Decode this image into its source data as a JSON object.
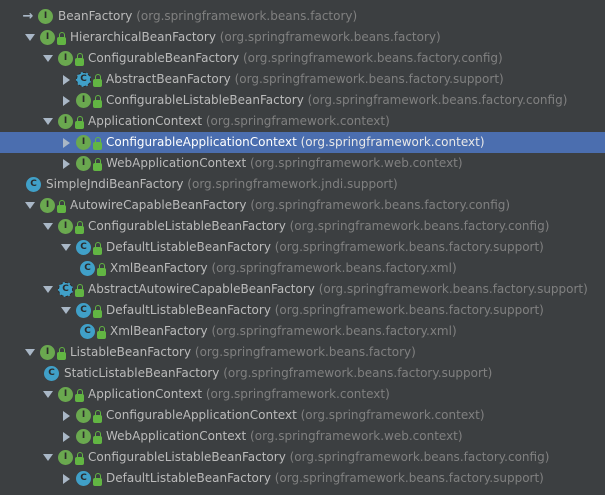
{
  "rows": [
    {
      "depth": 0,
      "expand": "root",
      "icon": "i",
      "lock": false,
      "name": "BeanFactory",
      "pkg": "(org.springframework.beans.factory)"
    },
    {
      "depth": 1,
      "expand": "down",
      "icon": "i",
      "lock": true,
      "name": "HierarchicalBeanFactory",
      "pkg": "(org.springframework.beans.factory)"
    },
    {
      "depth": 2,
      "expand": "down",
      "icon": "i",
      "lock": true,
      "name": "ConfigurableBeanFactory",
      "pkg": "(org.springframework.beans.factory.config)"
    },
    {
      "depth": 3,
      "expand": "right",
      "icon": "a",
      "lock": true,
      "name": "AbstractBeanFactory",
      "pkg": "(org.springframework.beans.factory.support)"
    },
    {
      "depth": 3,
      "expand": "right",
      "icon": "i",
      "lock": true,
      "name": "ConfigurableListableBeanFactory",
      "pkg": "(org.springframework.beans.factory.config)"
    },
    {
      "depth": 2,
      "expand": "down",
      "icon": "i",
      "lock": true,
      "name": "ApplicationContext",
      "pkg": "(org.springframework.context)"
    },
    {
      "depth": 3,
      "expand": "right",
      "icon": "i",
      "lock": true,
      "name": "ConfigurableApplicationContext",
      "pkg": "(org.springframework.context)",
      "selected": true
    },
    {
      "depth": 3,
      "expand": "right",
      "icon": "i",
      "lock": true,
      "name": "WebApplicationContext",
      "pkg": "(org.springframework.web.context)"
    },
    {
      "depth": 1,
      "expand": "none",
      "icon": "c",
      "lock": false,
      "name": "SimpleJndiBeanFactory",
      "pkg": "(org.springframework.jndi.support)"
    },
    {
      "depth": 1,
      "expand": "down",
      "icon": "i",
      "lock": true,
      "name": "AutowireCapableBeanFactory",
      "pkg": "(org.springframework.beans.factory.config)"
    },
    {
      "depth": 2,
      "expand": "down",
      "icon": "i",
      "lock": true,
      "name": "ConfigurableListableBeanFactory",
      "pkg": "(org.springframework.beans.factory.config)"
    },
    {
      "depth": 3,
      "expand": "down",
      "icon": "c",
      "lock": true,
      "name": "DefaultListableBeanFactory",
      "pkg": "(org.springframework.beans.factory.support)"
    },
    {
      "depth": 4,
      "expand": "none",
      "icon": "c",
      "lock": true,
      "name": "XmlBeanFactory",
      "pkg": "(org.springframework.beans.factory.xml)"
    },
    {
      "depth": 2,
      "expand": "down",
      "icon": "a",
      "lock": true,
      "name": "AbstractAutowireCapableBeanFactory",
      "pkg": "(org.springframework.beans.factory.support)"
    },
    {
      "depth": 3,
      "expand": "down",
      "icon": "c",
      "lock": true,
      "name": "DefaultListableBeanFactory",
      "pkg": "(org.springframework.beans.factory.support)"
    },
    {
      "depth": 4,
      "expand": "none",
      "icon": "c",
      "lock": true,
      "name": "XmlBeanFactory",
      "pkg": "(org.springframework.beans.factory.xml)"
    },
    {
      "depth": 1,
      "expand": "down",
      "icon": "i",
      "lock": true,
      "name": "ListableBeanFactory",
      "pkg": "(org.springframework.beans.factory)"
    },
    {
      "depth": 2,
      "expand": "none",
      "icon": "c",
      "lock": false,
      "name": "StaticListableBeanFactory",
      "pkg": "(org.springframework.beans.factory.support)"
    },
    {
      "depth": 2,
      "expand": "down",
      "icon": "i",
      "lock": true,
      "name": "ApplicationContext",
      "pkg": "(org.springframework.context)"
    },
    {
      "depth": 3,
      "expand": "right",
      "icon": "i",
      "lock": true,
      "name": "ConfigurableApplicationContext",
      "pkg": "(org.springframework.context)"
    },
    {
      "depth": 3,
      "expand": "right",
      "icon": "i",
      "lock": true,
      "name": "WebApplicationContext",
      "pkg": "(org.springframework.web.context)"
    },
    {
      "depth": 2,
      "expand": "down",
      "icon": "i",
      "lock": true,
      "name": "ConfigurableListableBeanFactory",
      "pkg": "(org.springframework.beans.factory.config)"
    },
    {
      "depth": 3,
      "expand": "right",
      "icon": "c",
      "lock": true,
      "name": "DefaultListableBeanFactory",
      "pkg": "(org.springframework.beans.factory.support)"
    }
  ],
  "icon_letters": {
    "i": "I",
    "c": "C",
    "a": "C"
  },
  "colors": {
    "background": "#3c3f41",
    "selection": "#4b6eaf",
    "interface_icon": "#6aa84f",
    "class_icon": "#40a0c8",
    "package_text": "#808080"
  }
}
